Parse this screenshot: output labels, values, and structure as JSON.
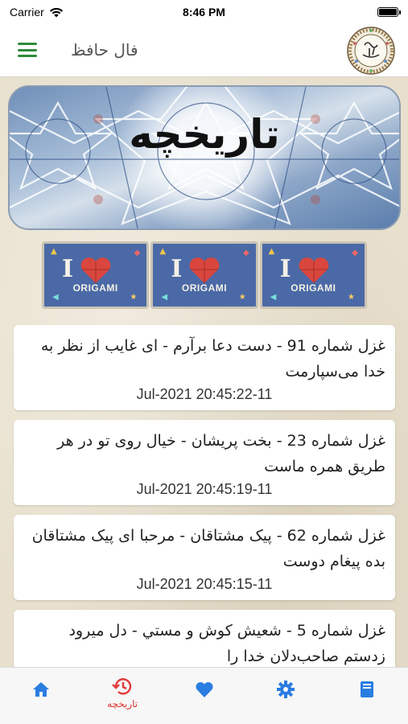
{
  "status_bar": {
    "carrier": "Carrier",
    "time": "8:46 PM"
  },
  "nav": {
    "title": "فال حافظ",
    "logo_text": "فال حافظ"
  },
  "banner": {
    "title": "تاریخچه"
  },
  "origami": {
    "items": [
      {
        "letter": "I",
        "word": "ORIGAMI"
      },
      {
        "letter": "I",
        "word": "ORIGAMI"
      },
      {
        "letter": "I",
        "word": "ORIGAMI"
      }
    ]
  },
  "history": {
    "items": [
      {
        "title": "غزل شماره 91 - دست دعا برآرم - ای غایب از نظر به خدا می‌سپارمت",
        "date": "Jul-2021 20:45:22-11"
      },
      {
        "title": "غزل شماره 23 - بخت پریشان - خیال روی تو در هر طریق همره ماست",
        "date": "Jul-2021 20:45:19-11"
      },
      {
        "title": "غزل شماره 62 - پیک مشتاقان - مرحبا ای پیک مشتاقان بده پیغام دوست",
        "date": "Jul-2021 20:45:15-11"
      },
      {
        "title": "غزل شماره 5 - شعیش کوش و مستي - دل میرود زدستم صاحب‌دلان خدا را",
        "date": ""
      }
    ]
  },
  "tabs": [
    {
      "name": "home",
      "label": "",
      "icon": "home-icon",
      "color": "#2a7de1"
    },
    {
      "name": "history",
      "label": "تاریخچه",
      "icon": "history-icon",
      "color": "#e03a3a"
    },
    {
      "name": "favorites",
      "label": "",
      "icon": "heart-icon",
      "color": "#2a7de1"
    },
    {
      "name": "settings",
      "label": "",
      "icon": "gear-icon",
      "color": "#2a7de1"
    },
    {
      "name": "book",
      "label": "",
      "icon": "book-icon",
      "color": "#2a7de1"
    }
  ]
}
